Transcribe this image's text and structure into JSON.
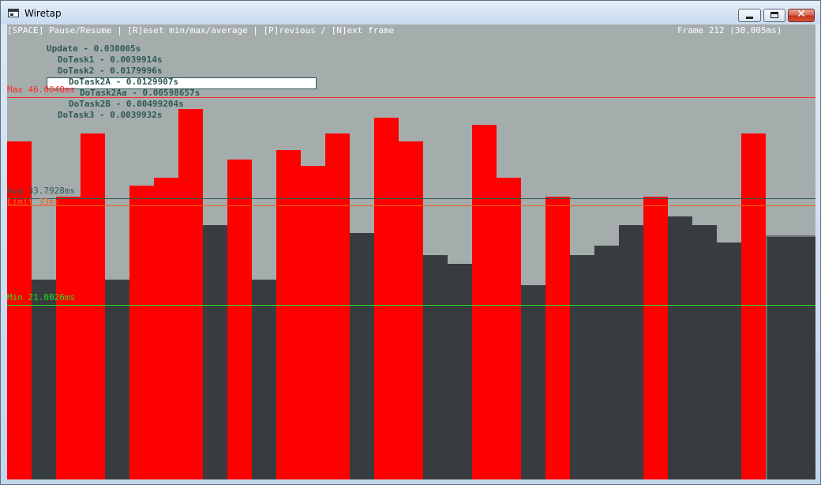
{
  "window": {
    "title": "Wiretap"
  },
  "header": {
    "help": "[SPACE] Pause/Resume | [R]eset min/max/average | [P]revious / [N]ext frame",
    "frame": "Frame 212 (30.005ms)"
  },
  "tree": [
    {
      "label": "Update - 0.030005s",
      "depth": 0,
      "selected": false
    },
    {
      "label": "DoTask1 - 0.0039914s",
      "depth": 1,
      "selected": false
    },
    {
      "label": "DoTask2 - 0.0179996s",
      "depth": 1,
      "selected": false
    },
    {
      "label": "DoTask2A - 0.0129907s",
      "depth": 2,
      "selected": true
    },
    {
      "label": "DoTask2Aa - 0.00598657s",
      "depth": 3,
      "selected": false
    },
    {
      "label": "DoTask2B - 0.00499204s",
      "depth": 2,
      "selected": false
    },
    {
      "label": "DoTask3 - 0.0039932s",
      "depth": 1,
      "selected": false
    }
  ],
  "chart_data": {
    "type": "bar",
    "unit": "ms",
    "ylim": [
      0,
      54.7
    ],
    "reference_lines": {
      "max": {
        "label": "Max 46.0048ms",
        "value": 46.0048,
        "color": "#ff2a2a"
      },
      "avg": {
        "label": "Avg 33.7928ms",
        "value": 33.7928,
        "color": "#2d5a56"
      },
      "limit": {
        "label": "Limit 33ms",
        "value": 33.0,
        "color": "#e8641e"
      },
      "min": {
        "label": "Min 21.0026ms",
        "value": 21.0026,
        "color": "#22dd22"
      }
    },
    "over_limit_color": "#ff0000",
    "under_limit_color": "#373d3f",
    "values": [
      40.6,
      24.0,
      34.0,
      41.6,
      24.0,
      35.3,
      36.3,
      44.5,
      30.6,
      38.5,
      24.0,
      39.6,
      37.7,
      41.6,
      29.6,
      43.5,
      40.6,
      27.0,
      25.9,
      42.6,
      36.3,
      23.4,
      34.0,
      27.0,
      28.1,
      30.6,
      34.0,
      31.6,
      30.6,
      28.5,
      41.6,
      29.3
    ],
    "current_index": 31
  }
}
